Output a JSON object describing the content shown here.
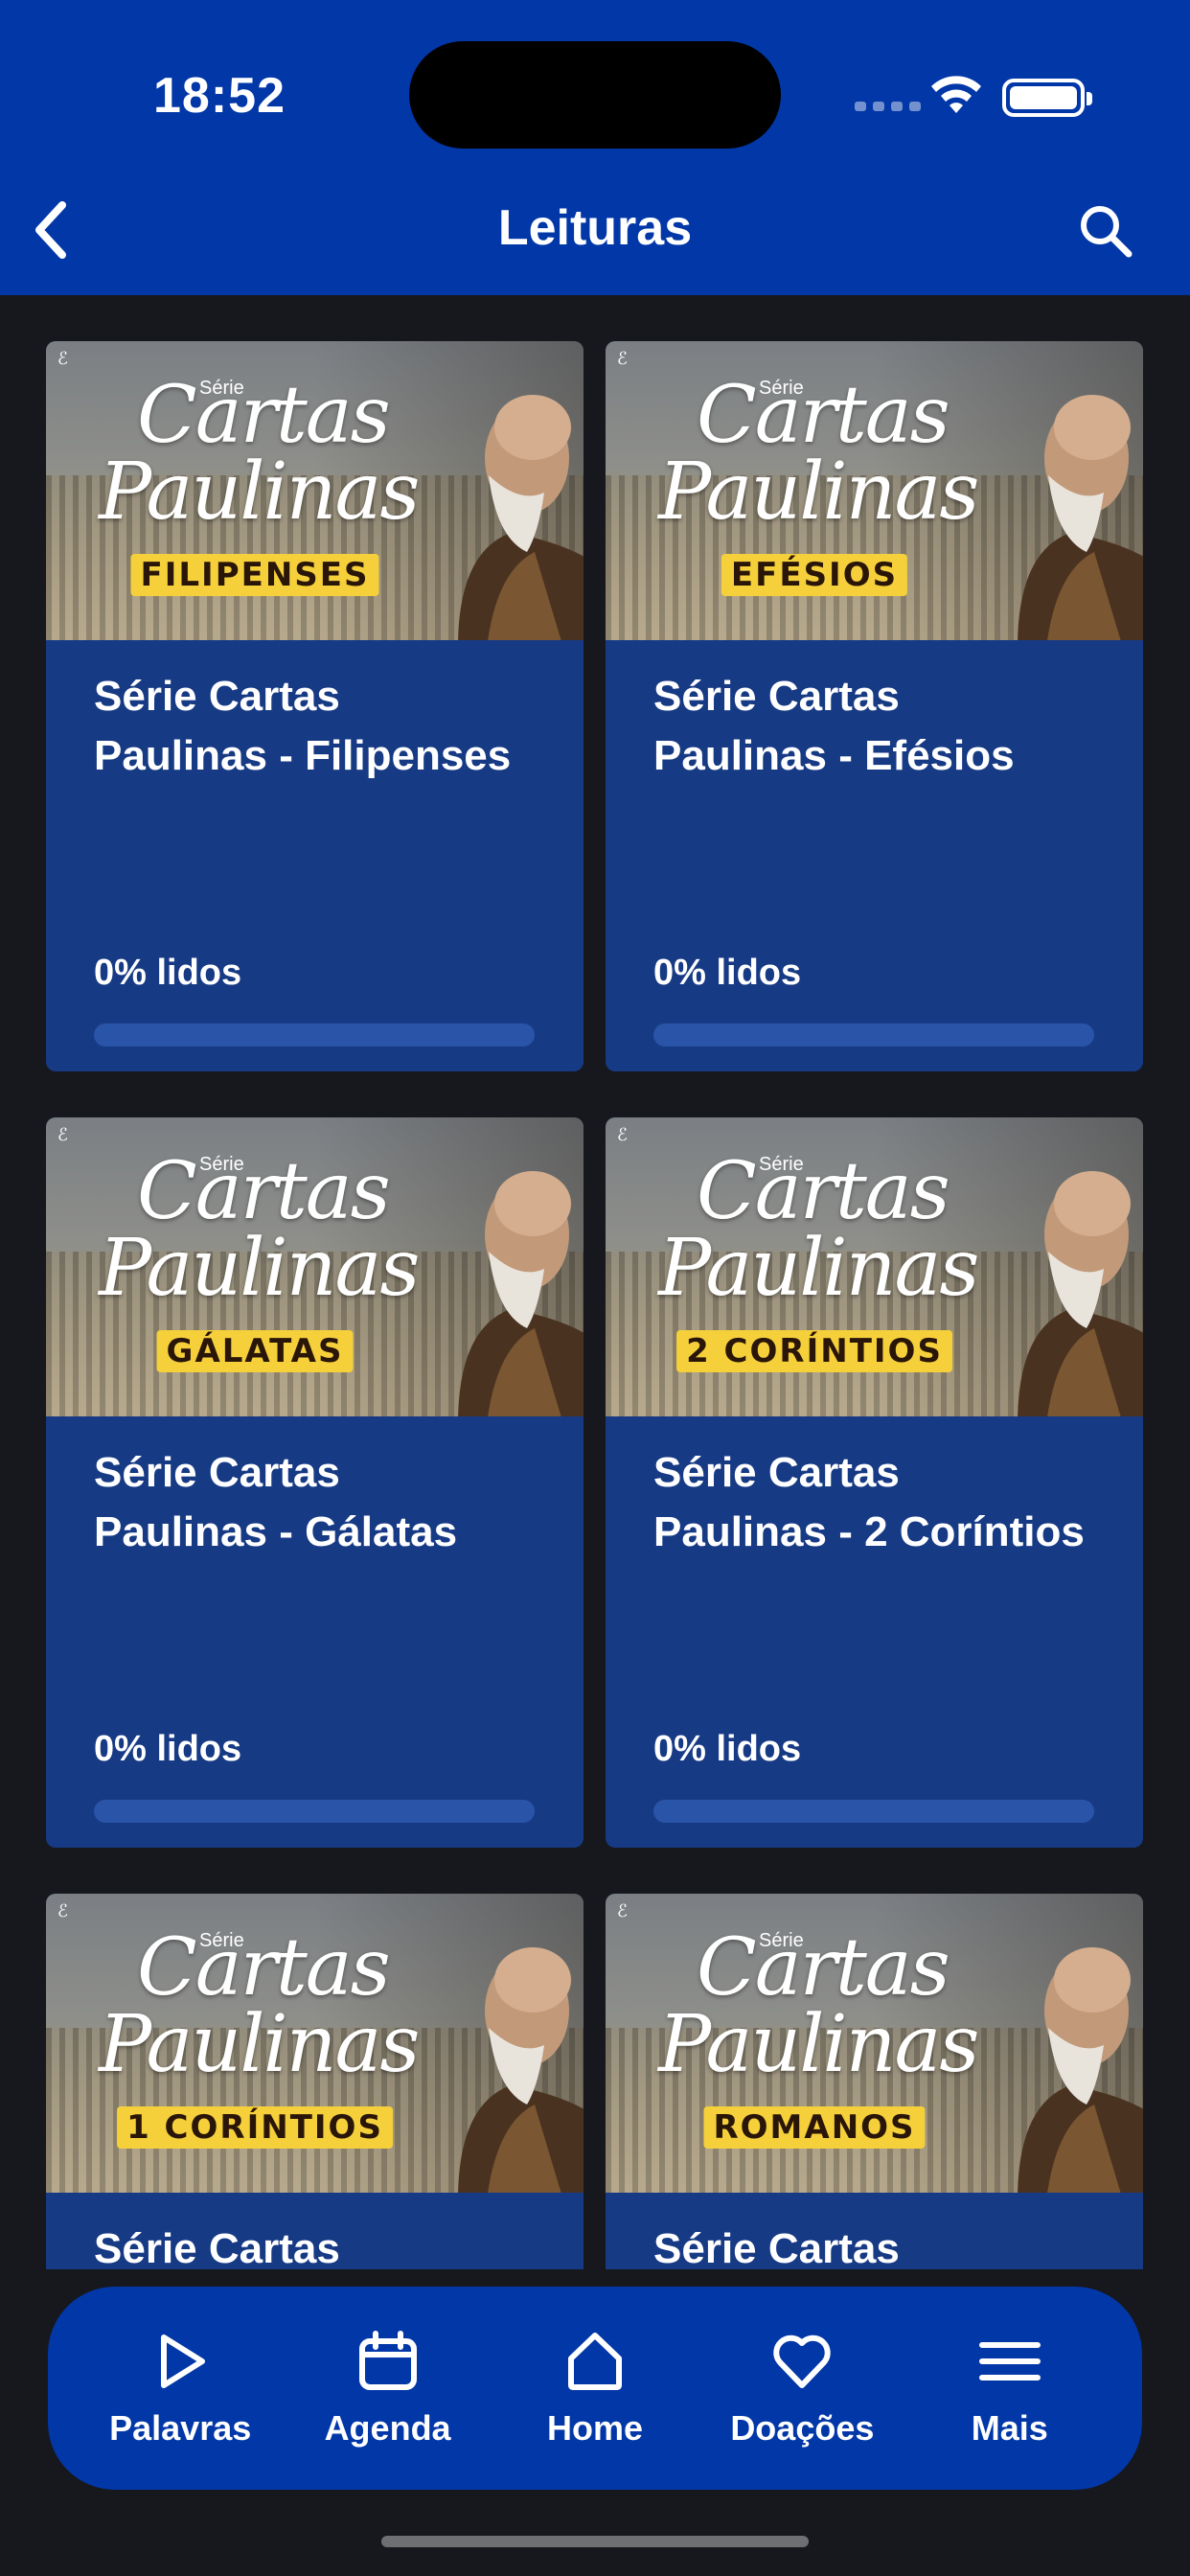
{
  "status_bar": {
    "time": "18:52"
  },
  "header": {
    "title": "Leituras"
  },
  "cards": [
    {
      "title_line1": "Série Cartas",
      "title_line2": "Paulinas - Filipenses",
      "thumb_serie": "Série",
      "thumb_script1": "Cartas",
      "thumb_script2": "Paulinas",
      "thumb_book": "FILIPENSES",
      "progress_label": "0% lidos",
      "progress": 0
    },
    {
      "title_line1": "Série Cartas",
      "title_line2": "Paulinas - Efésios",
      "thumb_serie": "Série",
      "thumb_script1": "Cartas",
      "thumb_script2": "Paulinas",
      "thumb_book": "EFÉSIOS",
      "progress_label": "0% lidos",
      "progress": 0
    },
    {
      "title_line1": "Série Cartas",
      "title_line2": "Paulinas - Gálatas",
      "thumb_serie": "Série",
      "thumb_script1": "Cartas",
      "thumb_script2": "Paulinas",
      "thumb_book": "GÁLATAS",
      "progress_label": "0% lidos",
      "progress": 0
    },
    {
      "title_line1": "Série Cartas",
      "title_line2": "Paulinas - 2 Coríntios",
      "thumb_serie": "Série",
      "thumb_script1": "Cartas",
      "thumb_script2": "Paulinas",
      "thumb_book": "2 CORÍNTIOS",
      "progress_label": "0% lidos",
      "progress": 0
    },
    {
      "title_line1": "Série Cartas",
      "title_line2": "",
      "thumb_serie": "Série",
      "thumb_script1": "Cartas",
      "thumb_script2": "Paulinas",
      "thumb_book": "1 CORÍNTIOS",
      "progress_label": "",
      "progress": 0
    },
    {
      "title_line1": "Série Cartas",
      "title_line2": "",
      "thumb_serie": "Série",
      "thumb_script1": "Cartas",
      "thumb_script2": "Paulinas",
      "thumb_book": "ROMANOS",
      "progress_label": "",
      "progress": 0
    }
  ],
  "tabbar": {
    "items": [
      {
        "label": "Palavras",
        "icon": "play-icon"
      },
      {
        "label": "Agenda",
        "icon": "calendar-icon"
      },
      {
        "label": "Home",
        "icon": "home-icon"
      },
      {
        "label": "Doações",
        "icon": "heart-icon"
      },
      {
        "label": "Mais",
        "icon": "menu-icon"
      }
    ]
  },
  "colors": {
    "header_bg": "#0237a8",
    "page_bg": "#16181d",
    "card_bg": "#173a85",
    "book_badge": "#f5d03a",
    "tab_active": "#ffffff",
    "tab_inactive": "#8fb0ee"
  }
}
